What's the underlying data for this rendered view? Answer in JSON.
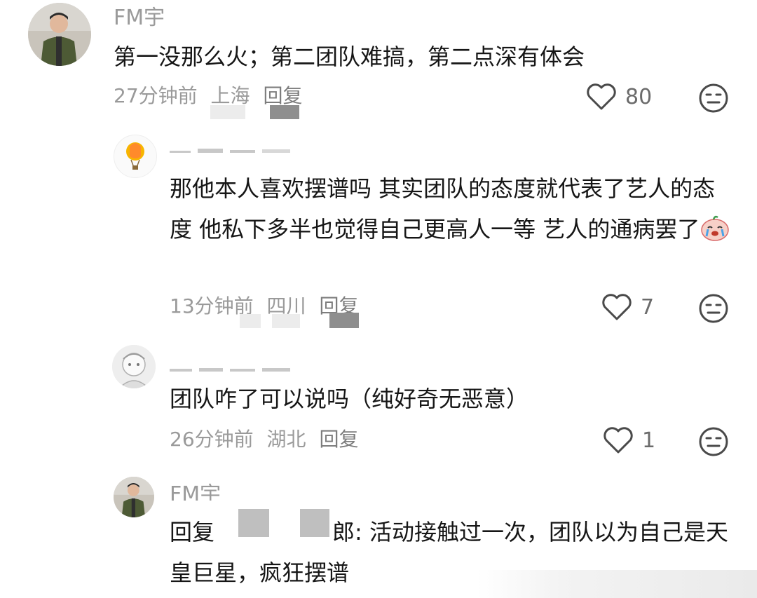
{
  "comments": [
    {
      "username": "FM宇",
      "content": "第一没那么火；第二团队难搞，第二点深有体会",
      "time": "27分钟前",
      "location": "上海",
      "reply_label": "回复",
      "likes": "80"
    },
    {
      "username": "",
      "content": "那他本人喜欢摆谱吗 其实团队的态度就代表了艺人的态度 他私下多半也觉得自己更高人一等 艺人的通病罢了",
      "time": "13分钟前",
      "location": "四川",
      "reply_label": "回复",
      "likes": "7"
    },
    {
      "username": "",
      "content": "团队咋了可以说吗（纯好奇无恶意）",
      "time": "26分钟前",
      "location": "湖北",
      "reply_label": "回复",
      "likes": "1"
    },
    {
      "username": "FM宇",
      "reply_prefix": "回复",
      "reply_tail": "郎: 活动接触过一次，团队以为自己是天皇巨星，疯狂摆谱"
    }
  ],
  "icons": {
    "like": "heart-outline-icon",
    "dislike": "neutral-face-icon",
    "emoji": "crying-emoji-icon"
  },
  "colors": {
    "text": "#161616",
    "meta": "#9a9a9a",
    "icon": "#4a4a4a"
  }
}
